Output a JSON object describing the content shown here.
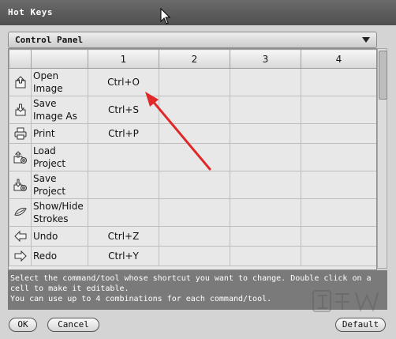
{
  "window": {
    "title": "Hot Keys"
  },
  "panel": {
    "selected": "Control Panel"
  },
  "table": {
    "headers": [
      "",
      "",
      "1",
      "2",
      "3",
      "4"
    ],
    "rows": [
      {
        "icon": "open-image-icon",
        "command": "Open Image",
        "shortcuts": [
          "Ctrl+O",
          "",
          "",
          ""
        ]
      },
      {
        "icon": "save-image-icon",
        "command": "Save Image As",
        "shortcuts": [
          "Ctrl+S",
          "",
          "",
          ""
        ]
      },
      {
        "icon": "print-icon",
        "command": "Print",
        "shortcuts": [
          "Ctrl+P",
          "",
          "",
          ""
        ]
      },
      {
        "icon": "load-project-icon",
        "command": "Load Project",
        "shortcuts": [
          "",
          "",
          "",
          ""
        ]
      },
      {
        "icon": "save-project-icon",
        "command": "Save Project",
        "shortcuts": [
          "",
          "",
          "",
          ""
        ]
      },
      {
        "icon": "show-hide-strokes-icon",
        "command": "Show/Hide Strokes",
        "shortcuts": [
          "",
          "",
          "",
          ""
        ]
      },
      {
        "icon": "undo-icon",
        "command": "Undo",
        "shortcuts": [
          "Ctrl+Z",
          "",
          "",
          ""
        ]
      },
      {
        "icon": "redo-icon",
        "command": "Redo",
        "shortcuts": [
          "Ctrl+Y",
          "",
          "",
          ""
        ]
      }
    ]
  },
  "help": {
    "line1": "Select the command/tool whose shortcut you want to change. Double click on a cell to make it editable.",
    "line2": "You can use up to 4 combinations for each command/tool."
  },
  "buttons": {
    "ok": "OK",
    "cancel": "Cancel",
    "default": "Default"
  },
  "colors": {
    "annotation_arrow": "#e0282a",
    "help_bg": "#7a7a7a"
  }
}
